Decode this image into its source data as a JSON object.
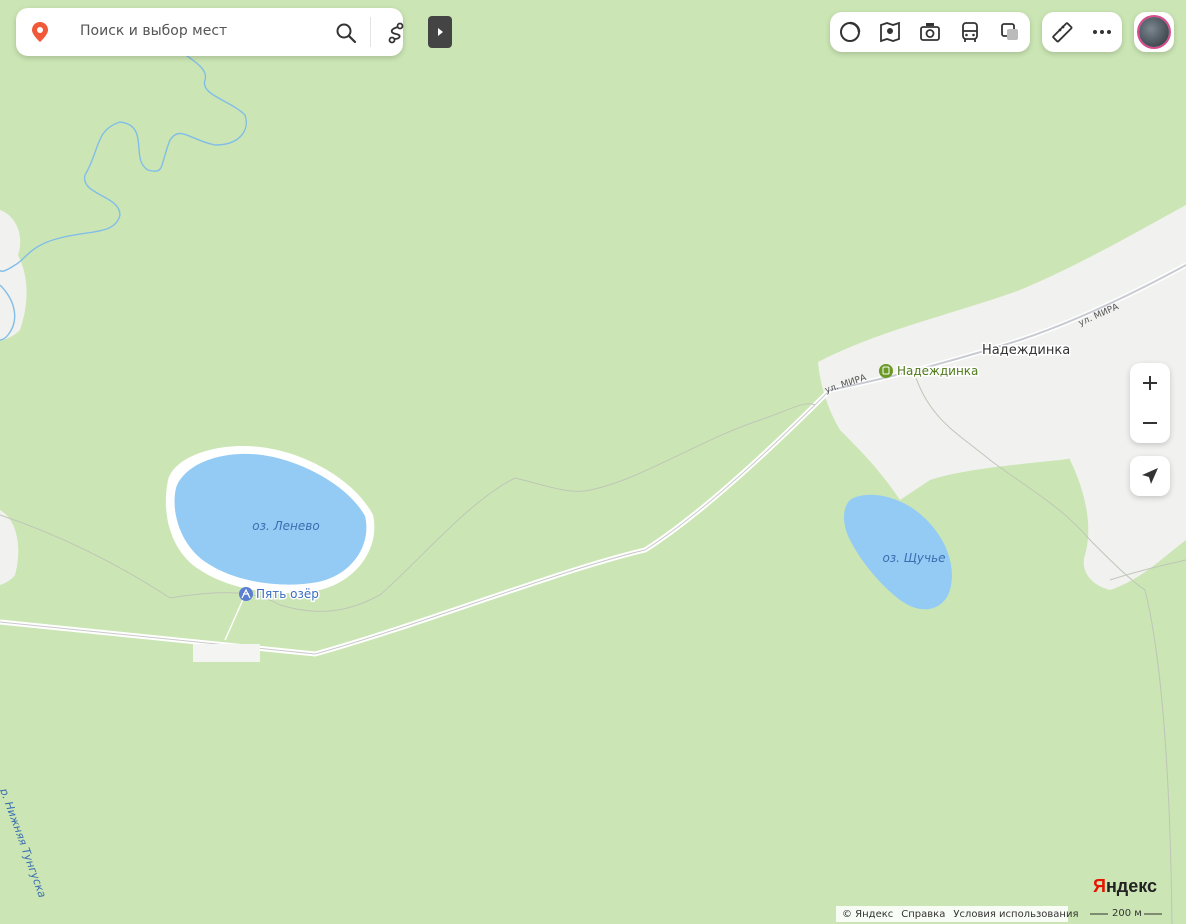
{
  "search": {
    "placeholder": "Поиск и выбор мест"
  },
  "map_labels": {
    "lake_lenevo": "оз. Ленево",
    "lake_shchuchye": "оз. Щучье",
    "poi_five_lakes": "Пять озёр",
    "village": "Надеждинка",
    "station": "Надеждинка",
    "street_1": "ул. МИРА",
    "street_2": "ул. МИРА",
    "river": "р. Нижняя Тунгуска"
  },
  "controls": {
    "zoom_in": "+",
    "zoom_out": "−"
  },
  "footer": {
    "copyright": "© Яндекс",
    "help": "Справка",
    "terms": "Условия использования"
  },
  "scale": {
    "label": "200 м"
  },
  "logo": {
    "first": "Я",
    "rest": "ндекс"
  },
  "colors": {
    "forest": "#cbe6b4",
    "water": "#93cbf5",
    "settlement": "#f1f1ef",
    "road": "#ffffff",
    "lake_label": "#3a6fb0",
    "poi_label": "#3b6ec1",
    "station_label": "#4f7a1c",
    "pin": "#f05a3a"
  },
  "icons": [
    "map-pin-icon",
    "search-icon",
    "route-icon",
    "collapse-icon",
    "traffic-icon",
    "panorama-icon",
    "camera-icon",
    "transit-icon",
    "layers-icon",
    "ruler-icon",
    "more-icon",
    "locate-icon",
    "attraction-icon",
    "railway-station-icon"
  ]
}
